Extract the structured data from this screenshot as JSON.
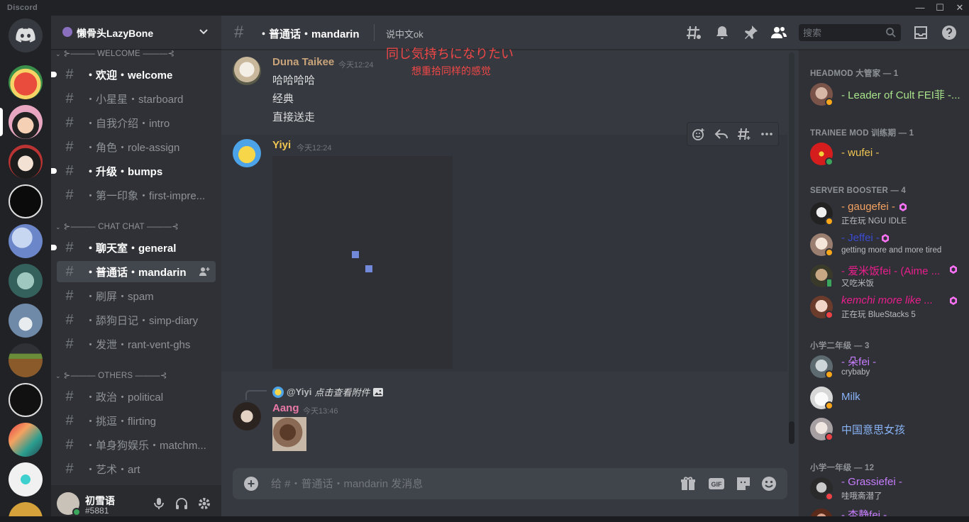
{
  "app": {
    "brand": "Discord"
  },
  "window_controls": [
    "—",
    "☐",
    "✕"
  ],
  "colors": {
    "accent": "#5865f2",
    "online": "#3ba55c",
    "idle": "#faa61a",
    "dnd": "#ed4245",
    "boost": "#ff73fa",
    "mod_green": "#a8e28a",
    "mod_yellow": "#f0c552",
    "booster_name": "#f4a261"
  },
  "guild": {
    "name": "懒骨头LazyBone"
  },
  "categories": [
    {
      "label": "WELCOME"
    },
    {
      "label": "CHAT CHAT"
    },
    {
      "label": "OTHERS"
    }
  ],
  "channels": [
    {
      "name": "・欢迎・welcome"
    },
    {
      "name": "・小星星・starboard"
    },
    {
      "name": "・自我介绍・intro"
    },
    {
      "name": "・角色・role-assign"
    },
    {
      "name": "・升级・bumps"
    },
    {
      "name": "・第一印象・first-impre..."
    },
    {
      "name": "・聊天室・general"
    },
    {
      "name": "・普通话・mandarin"
    },
    {
      "name": "・刷屏・spam"
    },
    {
      "name": "・舔狗日记・simp-diary"
    },
    {
      "name": "・发泄・rant-vent-ghs"
    },
    {
      "name": "・政治・political"
    },
    {
      "name": "・挑逗・flirting"
    },
    {
      "name": "・单身狗娱乐・matchm..."
    },
    {
      "name": "・艺术・art"
    }
  ],
  "user": {
    "name": "初雪语",
    "tag": "#5881"
  },
  "header": {
    "channel": "・普通话・mandarin",
    "topic": "说中文ok"
  },
  "search": {
    "placeholder": "搜索"
  },
  "overlay": {
    "line1": "同じ気持ちになりたい",
    "line2": "想重拾同样的感觉"
  },
  "messages": [
    {
      "author": "Duna Taikee",
      "time": "今天12:24",
      "lines": [
        "哈哈哈哈",
        "经典",
        "直接送走"
      ]
    },
    {
      "author": "Yiyi",
      "time": "今天12:24"
    },
    {
      "reply_to": "@Yiyi",
      "reply_text": "点击查看附件",
      "author": "Aang",
      "time": "今天13:46"
    }
  ],
  "composer": {
    "placeholder": "给 #・普通话・mandarin 发消息"
  },
  "member_groups": [
    {
      "label": "HEADMOD 大管家 — 1"
    },
    {
      "label": "TRAINEE MOD 训练期 — 1"
    },
    {
      "label": "SERVER BOOSTER — 4"
    },
    {
      "label": "小学二年级 — 3"
    },
    {
      "label": "小学一年级 — 12"
    }
  ],
  "members": [
    {
      "name": "- Leader of Cult FEI菲 -...",
      "color": "#a8e28a",
      "status": "idle"
    },
    {
      "name": "- wufei -",
      "color": "#f0c552",
      "status": "online"
    },
    {
      "name": "- gaugefei -",
      "activity": "正在玩 NGU IDLE",
      "color": "#f4a261",
      "status": "idle"
    },
    {
      "name": "- Jeffei -",
      "activity": "getting more and more tired",
      "color": "#3b4bd1",
      "status": "idle"
    },
    {
      "name": "- 爱米饭fei - (Aime ...",
      "activity": "又吃米饭",
      "color": "#e91e8c",
      "status": "mobile"
    },
    {
      "name": "kemchi more like ...",
      "activity": "正在玩 BlueStacks 5",
      "color": "#e91e8c",
      "status": "dnd"
    },
    {
      "name": "- 朵fei -",
      "activity": "crybaby",
      "color": "#c77dff",
      "status": "idle"
    },
    {
      "name": "Milk",
      "color": "#8ab4f8",
      "status": "idle"
    },
    {
      "name": "中国意思女孩",
      "color": "#8ab4f8",
      "status": "dnd"
    },
    {
      "name": "- Grassiefei -",
      "activity": "哇哦斋潜了",
      "color": "#c77dff",
      "status": "dnd"
    },
    {
      "name": "- 杏静fei -",
      "color": "#c77dff",
      "status": "dnd"
    }
  ]
}
